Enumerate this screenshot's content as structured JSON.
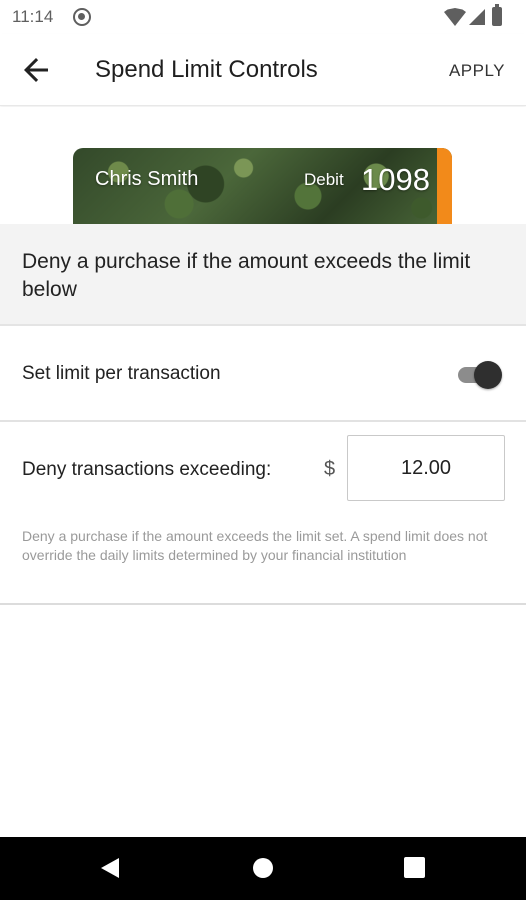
{
  "status_bar": {
    "time": "11:14",
    "icons": [
      "at-sign-icon",
      "wifi-icon",
      "signal-icon",
      "battery-icon"
    ]
  },
  "app_bar": {
    "back_icon": "arrow-left-icon",
    "title": "Spend Limit Controls",
    "apply_label": "APPLY"
  },
  "card": {
    "holder_name": "Chris Smith",
    "type": "Debit",
    "last4": "1098",
    "accent_color": "#f28a1a"
  },
  "info_banner": {
    "text": "Deny a purchase if the amount exceeds the limit below"
  },
  "toggle_row": {
    "label": "Set limit per transaction",
    "enabled": true
  },
  "limit_row": {
    "label": "Deny transactions exceeding:",
    "currency_symbol": "$",
    "amount": "12.00",
    "help_text": "Deny a purchase if the amount exceeds the limit set. A spend limit does not override the daily limits determined by your financial institution"
  },
  "nav_bar": {
    "icons": [
      "triangle-back-icon",
      "circle-home-icon",
      "square-recents-icon"
    ]
  }
}
